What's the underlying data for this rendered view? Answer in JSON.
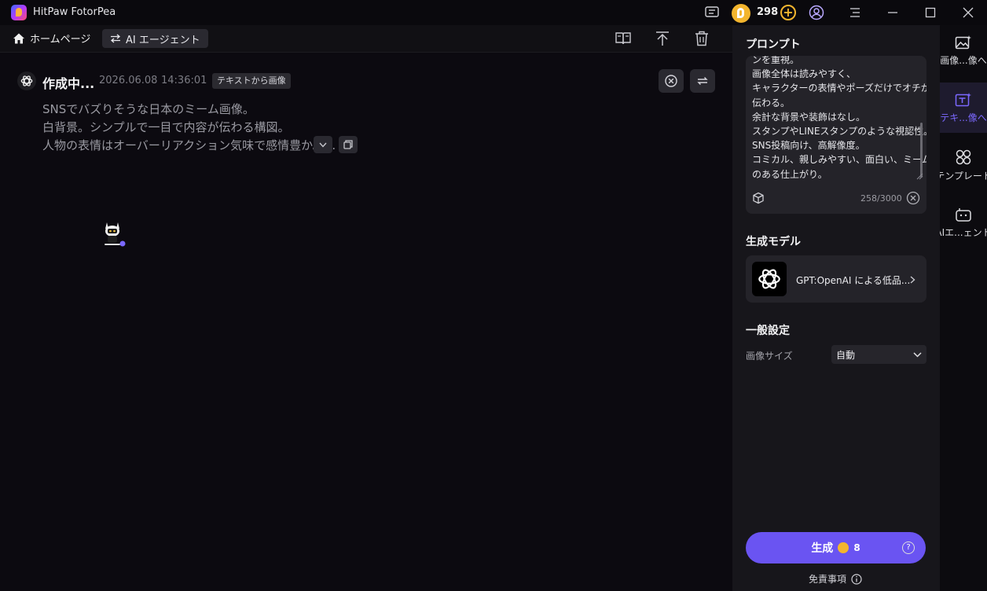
{
  "app": {
    "title": "HitPaw FotorPea",
    "coins": "298"
  },
  "toolbar": {
    "home_label": "ホームページ",
    "agent_label": "AI エージェント"
  },
  "task": {
    "status": "作成中...",
    "date": "2026.06.08",
    "time": "14:36:01",
    "tag": "テキストから画像",
    "prompt_lines": [
      "SNSでバズりそうな日本のミーム画像。",
      "白背景。シンプルで一目で内容が伝わる構図。",
      "人物の表情はオーバーリアクション気味で感情豊か。..."
    ]
  },
  "panel": {
    "prompt_title": "プロンプト",
    "prompt_lines": [
      "ンを重視。",
      "画像全体は読みやすく、",
      "キャラクターの表情やポーズだけでオチが",
      "伝わる。",
      "余計な背景や装飾はなし。",
      "スタンプやLINEスタンプのような視認性。",
      "SNS投稿向け、高解像度。",
      "コミカル、親しみやすい、面白い、ミーム感",
      "のある仕上がり。"
    ],
    "char_count": "258/3000",
    "model_title": "生成モデル",
    "model_name": "GPT:OpenAI による低品...",
    "settings_title": "一般設定",
    "size_label": "画像サイズ",
    "size_value": "自動",
    "generate_label": "生成",
    "generate_cost": "8",
    "disclaimer": "免責事項"
  },
  "sidenav": {
    "items": [
      {
        "label": "画像...像へ"
      },
      {
        "label": "テキ...像へ"
      },
      {
        "label": "テンプレート"
      },
      {
        "label": "AIエ...ェント"
      }
    ]
  },
  "colors": {
    "accent": "#6a54f2",
    "coin": "#f3b52e",
    "active_nav": "#7b68ff"
  }
}
